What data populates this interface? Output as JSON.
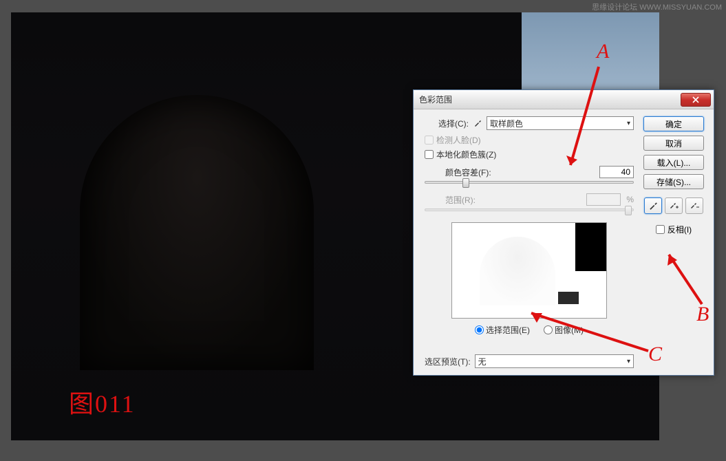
{
  "watermark": "思缘设计论坛  WWW.MISSYUAN.COM",
  "figure_label": "图011",
  "annotations": {
    "a": "A",
    "b": "B",
    "c": "C"
  },
  "dialog": {
    "title": "色彩范围",
    "select_label": "选择(C):",
    "select_value": "取样颜色",
    "detect_faces": "检测人脸(D)",
    "localized": "本地化颜色簇(Z)",
    "fuzziness_label": "颜色容差(F):",
    "fuzziness_value": "40",
    "range_label": "范围(R):",
    "range_unit": "%",
    "radio_selection": "选择范围(E)",
    "radio_image": "图像(M)",
    "preview_label": "选区预览(T):",
    "preview_value": "无",
    "buttons": {
      "ok": "确定",
      "cancel": "取消",
      "load": "载入(L)...",
      "save": "存储(S)..."
    },
    "invert": "反相(I)"
  }
}
